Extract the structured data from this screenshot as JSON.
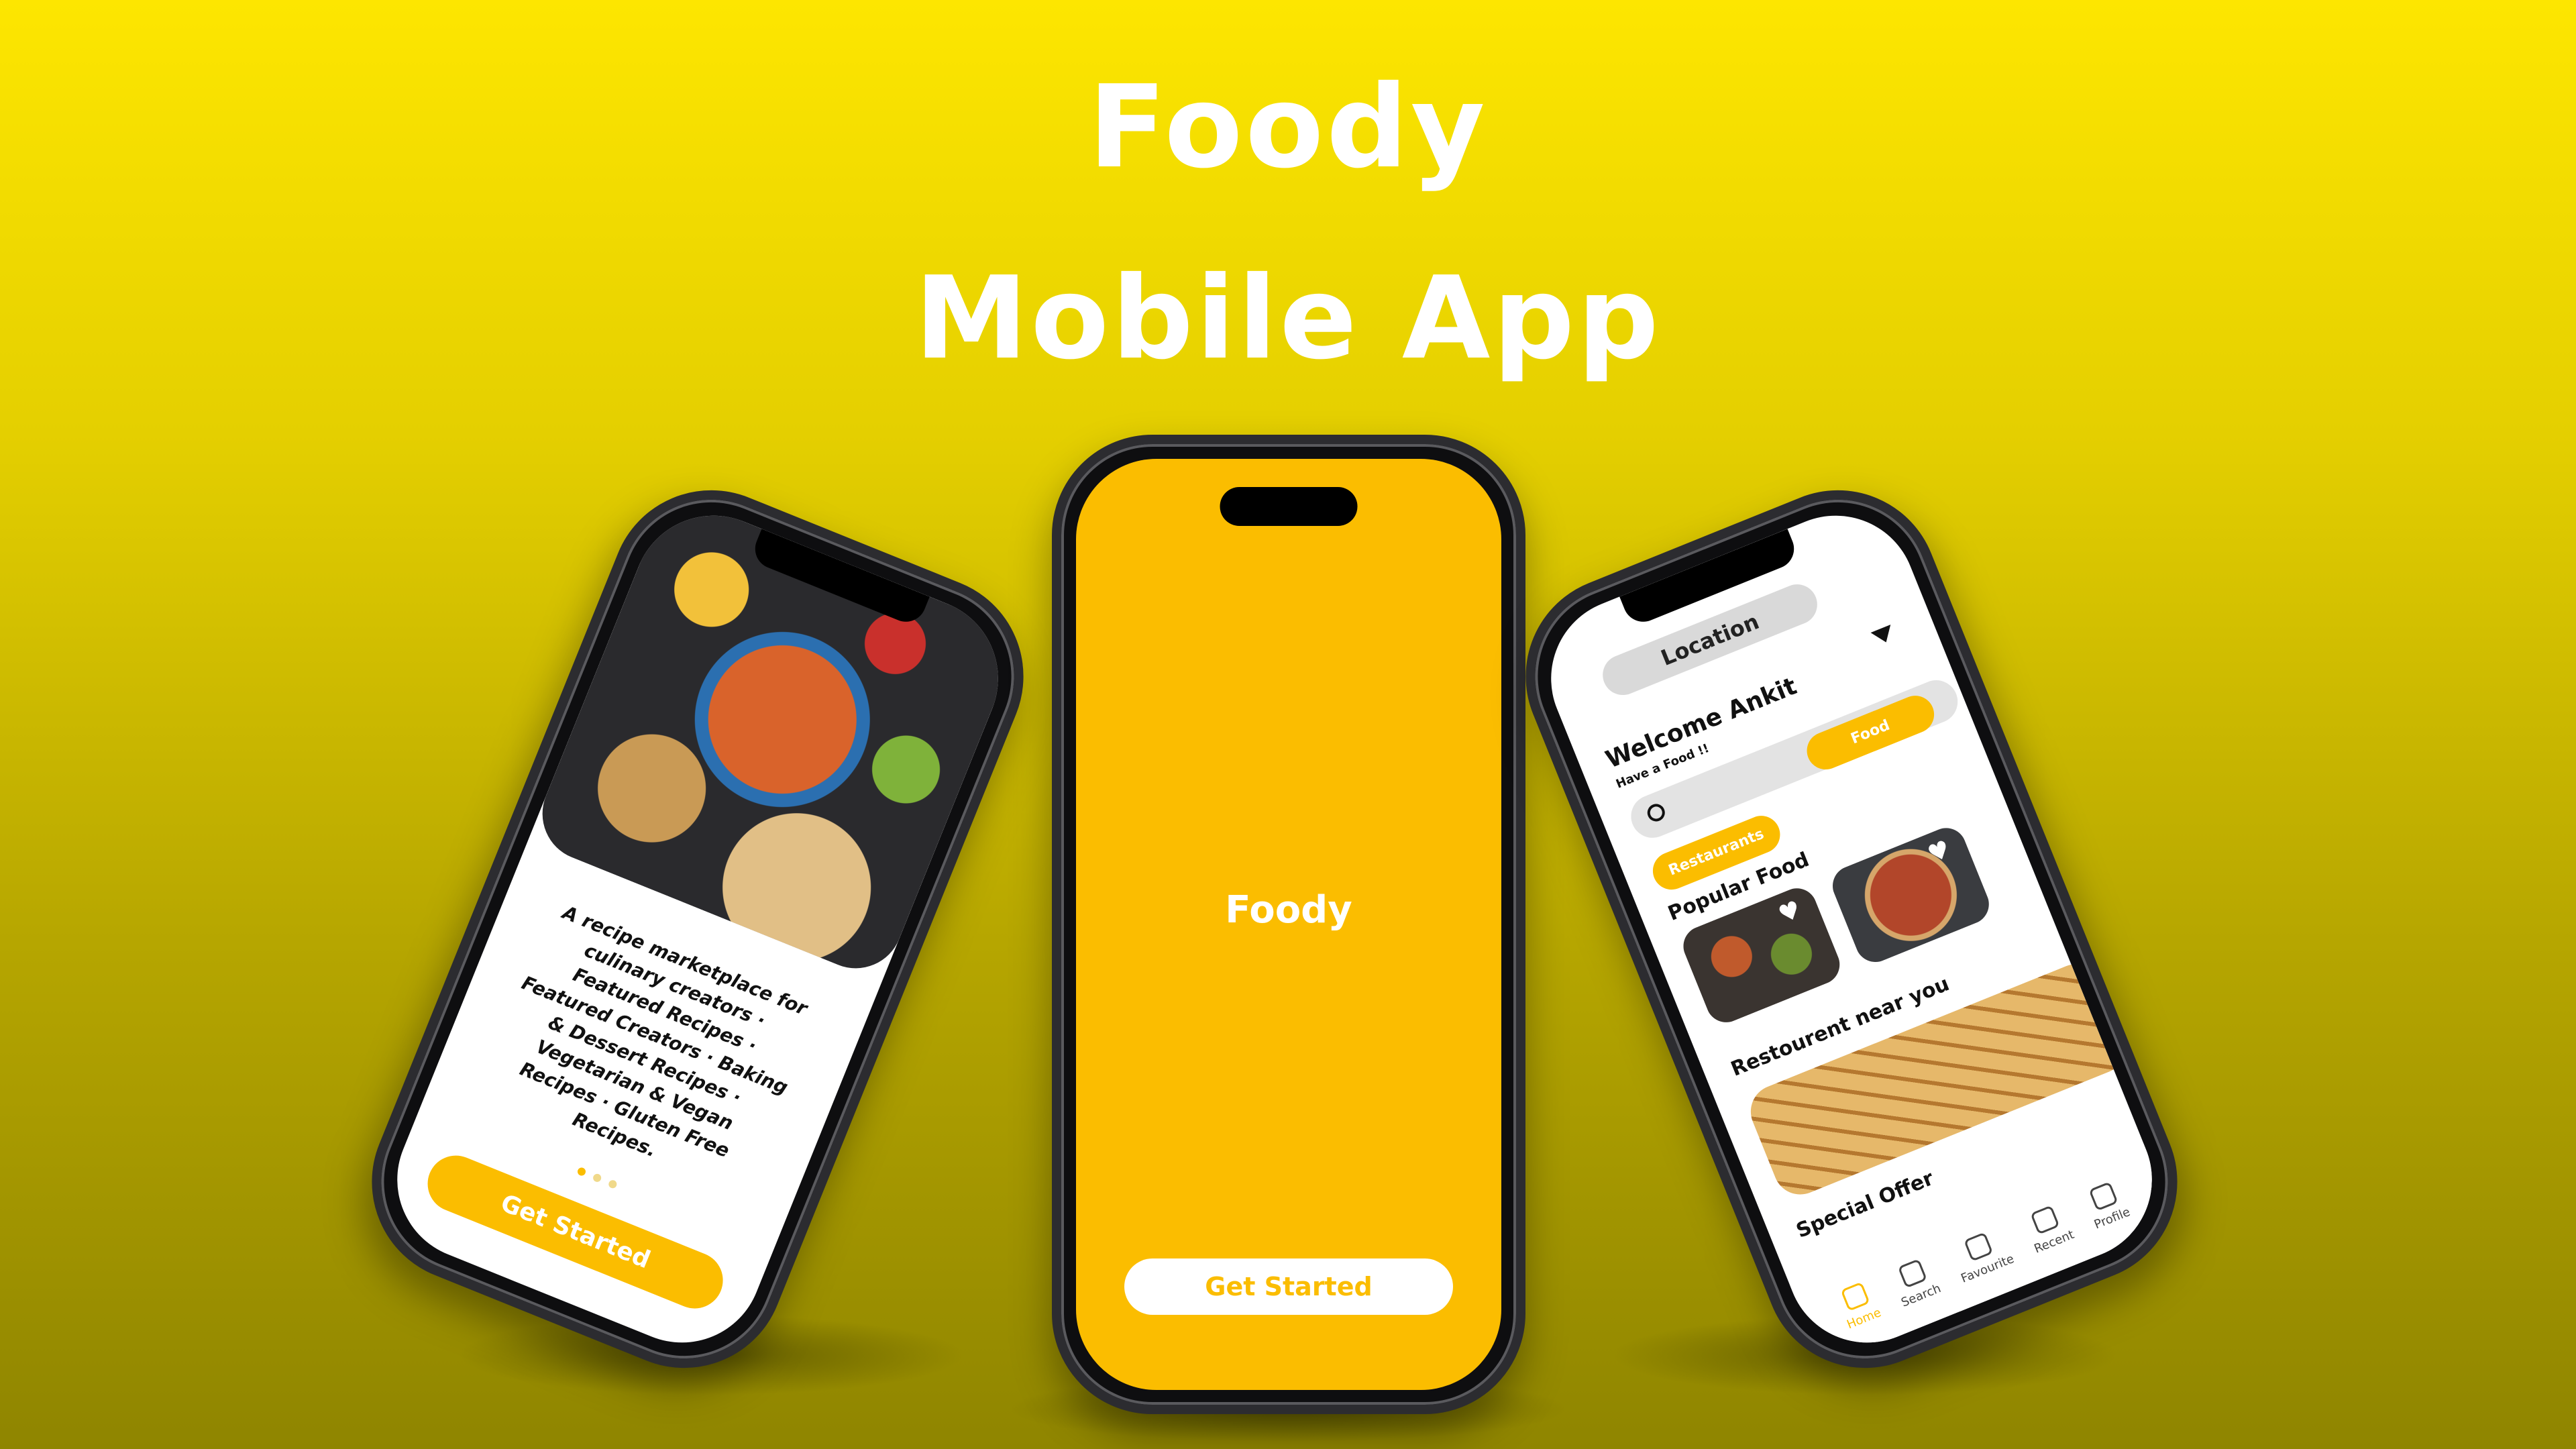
{
  "headline": {
    "line1": "Foody",
    "line2": "Mobile App"
  },
  "center_phone": {
    "logo": "Foody",
    "cta": "Get Started"
  },
  "left_phone": {
    "description": "A recipe marketplace for culinary creators · Featured Recipes · Featured Creators · Baking & Dessert Recipes · Vegetarian & Vegan Recipes · Gluten Free Recipes.",
    "cta": "Get Started"
  },
  "right_phone": {
    "location": "Location",
    "welcome": "Welcome Ankit",
    "subtitle": "Have a Food !!",
    "chips": [
      "Restaurants",
      "Food"
    ],
    "sections": {
      "popular": "Popular Food",
      "near": "Restourent near you",
      "offer": "Special Offer"
    },
    "tabs": [
      "Home",
      "Search",
      "Favourite",
      "Recent",
      "Profile"
    ]
  },
  "colors": {
    "accent": "#fbbd00",
    "text": "#111111"
  }
}
